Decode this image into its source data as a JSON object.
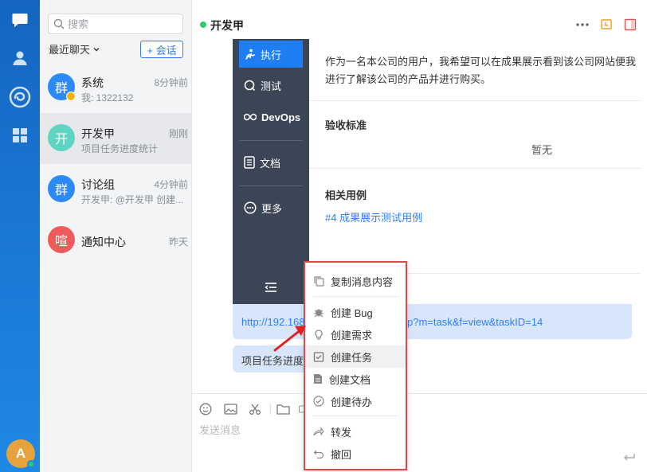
{
  "sidebar": {
    "avatar_letter": "A",
    "icons": [
      "chat-icon",
      "contacts-icon",
      "app-logo-icon",
      "apps-grid-icon"
    ]
  },
  "chat_list": {
    "search_placeholder": "搜索",
    "recent_label": "最近聊天",
    "new_chat_label": "+ 会话",
    "items": [
      {
        "avatar": "群",
        "avatar_color": "#2b8af7",
        "name": "系统",
        "time": "8分钟前",
        "preview": "我: 1322132"
      },
      {
        "avatar": "开",
        "avatar_color": "#5fd4c0",
        "name": "开发甲",
        "time": "刚刚",
        "preview": "项目任务进度统计"
      },
      {
        "avatar": "群",
        "avatar_color": "#2b8af7",
        "name": "讨论组",
        "time": "4分钟前",
        "preview": "开发甲: @开发甲 创建..."
      },
      {
        "avatar": "喧",
        "avatar_color": "#f05a5a",
        "name": "通知中心",
        "time": "昨天",
        "preview": ""
      }
    ]
  },
  "chat": {
    "title": "开发甲",
    "header_icons": [
      "more-icon",
      "pin-icon",
      "sidebar-toggle-icon"
    ]
  },
  "shared_screenshot": {
    "nav": [
      {
        "label": "执行",
        "active": true
      },
      {
        "label": "测试",
        "active": false
      },
      {
        "label": "DevOps",
        "active": false
      },
      {
        "label": "文档",
        "active": false
      },
      {
        "label": "更多",
        "active": false
      }
    ],
    "description": "作为一名本公司的用户，我希望可以在成果展示看到该公司网站便我进行了解该公司的产品并进行购买。",
    "acceptance_heading": "验收标准",
    "acceptance_value": "暂无",
    "cases_heading": "相关用例",
    "case_link": "#4 成果展示测试用例"
  },
  "messages": {
    "link_prefix": "http://192.168",
    "link_suffix": "p?m=task&f=view&taskID=14",
    "text_message": "项目任务进度"
  },
  "composer": {
    "placeholder": "发送消息",
    "tools": [
      "emoji-icon",
      "image-icon",
      "screenshot-icon",
      "folder-icon",
      "file-icon"
    ]
  },
  "context_menu": {
    "items": [
      {
        "label": "复制消息内容",
        "icon": "copy-icon"
      },
      {
        "label": "创建 Bug",
        "icon": "bug-icon"
      },
      {
        "label": "创建需求",
        "icon": "lightbulb-icon"
      },
      {
        "label": "创建任务",
        "icon": "task-icon",
        "hover": true
      },
      {
        "label": "创建文档",
        "icon": "document-icon"
      },
      {
        "label": "创建待办",
        "icon": "todo-check-icon"
      },
      {
        "label": "转发",
        "icon": "forward-icon"
      },
      {
        "label": "撤回",
        "icon": "undo-icon"
      }
    ],
    "highlight_color": "#e04848"
  }
}
